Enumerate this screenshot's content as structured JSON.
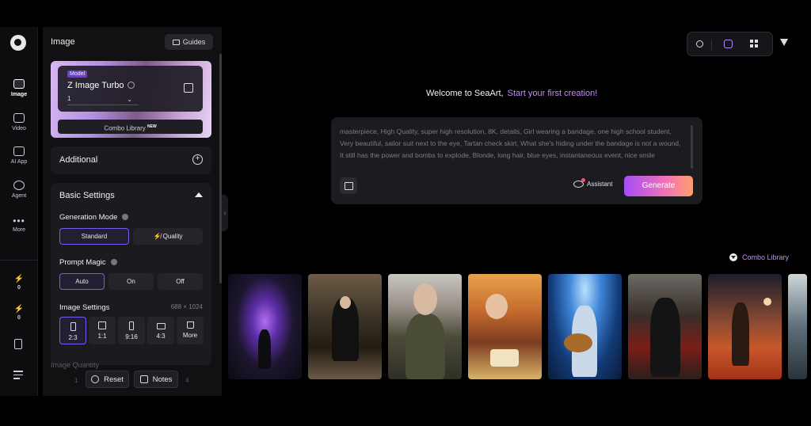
{
  "rail": {
    "items": [
      {
        "label": "Image",
        "icon": "image-icon"
      },
      {
        "label": "Video",
        "icon": "video-icon"
      },
      {
        "label": "AI App",
        "icon": "ai-app-icon"
      },
      {
        "label": "Agent",
        "icon": "agent-icon"
      },
      {
        "label": "More",
        "icon": "more-icon"
      }
    ],
    "stats": [
      {
        "value": "0",
        "icon": "bolt-yellow-icon"
      },
      {
        "value": "0",
        "icon": "bolt-purple-icon"
      }
    ]
  },
  "panel": {
    "title": "Image",
    "guides_label": "Guides",
    "model": {
      "tag": "Model",
      "name": "Z Image Turbo",
      "version": "1",
      "combo_library": "Combo Library",
      "combo_badge": "NEW"
    },
    "additional_label": "Additional",
    "basic_settings_label": "Basic Settings",
    "generation_mode": {
      "label": "Generation Mode",
      "options": [
        "Standard",
        "Quality"
      ],
      "selected": "Standard"
    },
    "prompt_magic": {
      "label": "Prompt Magic",
      "options": [
        "Auto",
        "On",
        "Off"
      ],
      "selected": "Auto"
    },
    "image_settings": {
      "label": "Image Settings",
      "size": "688 × 1024",
      "ratios": [
        "2:3",
        "1:1",
        "9:16",
        "4:3",
        "More"
      ],
      "selected": "2:3"
    },
    "image_quantity_label": "Image Quantity",
    "quantity_values": [
      "1",
      "4"
    ],
    "reset_label": "Reset",
    "notes_label": "Notes"
  },
  "main": {
    "welcome": "Welcome to SeaArt,",
    "welcome_highlight": "Start your first creation!",
    "prompt_text": "masterpiece, High Quality, super high resolution, 8K, details, Girl wearing a bandage, one high school student, Very beautiful, sailor suit next to the eye, Tartan check skirt, What she's hiding under the bandage is not a wound, It still has the power and bombs to explode, Blonde, long hair, blue eyes, instantaneous event, nice smile",
    "assistant_label": "Assistant",
    "generate_label": "Generate",
    "combo_library_link": "Combo Library"
  },
  "colors": {
    "accent": "#c58cf5",
    "generate_start": "#a54cf5",
    "generate_end": "#ff9e6c",
    "selected_border": "#7a5bf0"
  }
}
